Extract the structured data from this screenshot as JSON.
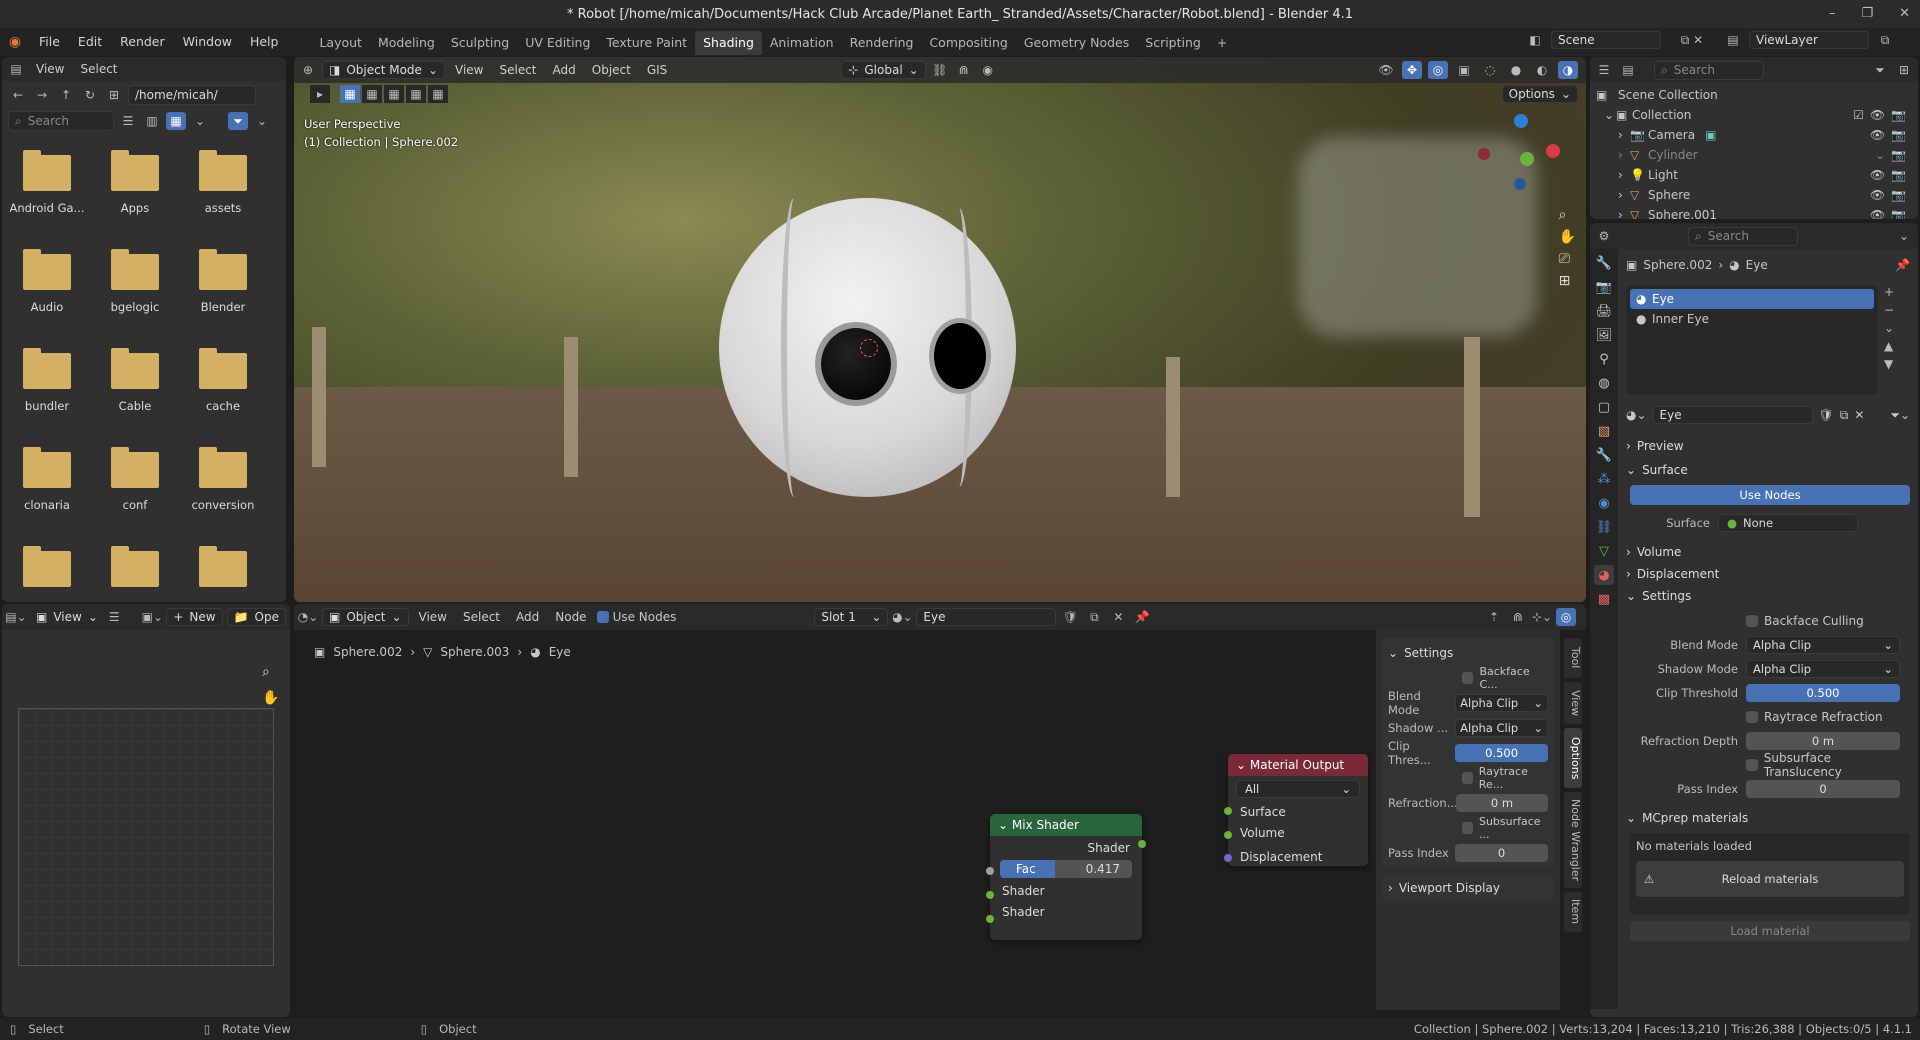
{
  "title": "* Robot [/home/micah/Documents/Hack Club Arcade/Planet Earth_ Stranded/Assets/Character/Robot.blend] - Blender 4.1",
  "menu": [
    "File",
    "Edit",
    "Render",
    "Window",
    "Help"
  ],
  "workspaces": [
    "Layout",
    "Modeling",
    "Sculpting",
    "UV Editing",
    "Texture Paint",
    "Shading",
    "Animation",
    "Rendering",
    "Compositing",
    "Geometry Nodes",
    "Scripting"
  ],
  "active_workspace": "Shading",
  "scene": "Scene",
  "viewlayer": "ViewLayer",
  "filebrowser": {
    "menu": [
      "View",
      "Select"
    ],
    "path": "/home/micah/",
    "search": "Search",
    "folders": [
      "Android Ga...",
      "Apps",
      "assets",
      "Audio",
      "bgelogic",
      "Blender",
      "bundler",
      "Cable",
      "cache",
      "clonaria",
      "conf",
      "conversion"
    ]
  },
  "viewport": {
    "mode": "Object Mode",
    "menu": [
      "View",
      "Select",
      "Add",
      "Object",
      "GIS"
    ],
    "transform": "Global",
    "options": "Options",
    "info1": "User Perspective",
    "info2": "(1) Collection | Sphere.002"
  },
  "outliner": {
    "search": "Search",
    "root": "Scene Collection",
    "collection": "Collection",
    "items": [
      "Camera",
      "Cylinder",
      "Light",
      "Sphere",
      "Sphere.001"
    ]
  },
  "properties": {
    "search": "Search",
    "breadcrumb_obj": "Sphere.002",
    "breadcrumb_mat": "Eye",
    "slots": [
      "Eye",
      "Inner Eye"
    ],
    "material": "Eye",
    "preview": "Preview",
    "surface": "Surface",
    "use_nodes": "Use Nodes",
    "surface_lbl": "Surface",
    "surface_val": "None",
    "volume": "Volume",
    "displacement": "Displacement",
    "settings": "Settings",
    "backface": "Backface Culling",
    "blend_lbl": "Blend Mode",
    "blend_val": "Alpha Clip",
    "shadow_lbl": "Shadow Mode",
    "shadow_val": "Alpha Clip",
    "clip_lbl": "Clip Threshold",
    "clip_val": "0.500",
    "raytrace": "Raytrace Refraction",
    "refr_lbl": "Refraction Depth",
    "refr_val": "0 m",
    "subsurface": "Subsurface Translucency",
    "pass_lbl": "Pass Index",
    "pass_val": "0",
    "mcprep": "MCprep materials",
    "no_mat": "No materials loaded",
    "reload": "Reload materials",
    "load": "Load material"
  },
  "imageeditor": {
    "view": "View",
    "new": "New",
    "open": "Ope"
  },
  "nodeeditor": {
    "type": "Object",
    "menu": [
      "View",
      "Select",
      "Add",
      "Node"
    ],
    "use_nodes": "Use Nodes",
    "slot": "Slot 1",
    "material": "Eye",
    "bc": [
      "Sphere.002",
      "Sphere.003",
      "Eye"
    ],
    "mix": {
      "title": "Mix Shader",
      "out": "Shader",
      "fac_lbl": "Fac",
      "fac_val": "0.417",
      "in1": "Shader",
      "in2": "Shader"
    },
    "output": {
      "title": "Material Output",
      "target": "All",
      "surface": "Surface",
      "volume": "Volume",
      "disp": "Displacement"
    },
    "sidebar": {
      "settings": "Settings",
      "backface": "Backface C...",
      "blend_lbl": "Blend Mode",
      "blend_val": "Alpha Clip",
      "shadow_lbl": "Shadow ...",
      "shadow_val": "Alpha Clip",
      "clip_lbl": "Clip Thres...",
      "clip_val": "0.500",
      "raytrace": "Raytrace Re...",
      "refr_lbl": "Refraction...",
      "refr_val": "0 m",
      "subsurface": "Subsurface ...",
      "pass_lbl": "Pass Index",
      "pass_val": "0",
      "vpdisplay": "Viewport Display"
    },
    "tabs": [
      "Tool",
      "View",
      "Options",
      "Node Wrangler",
      "Item"
    ]
  },
  "statusbar": {
    "select": "Select",
    "rotate": "Rotate View",
    "object": "Object",
    "stats": "Collection | Sphere.002 | Verts:13,204 | Faces:13,210 | Tris:26,388 | Objects:0/5 | 4.1.1"
  }
}
